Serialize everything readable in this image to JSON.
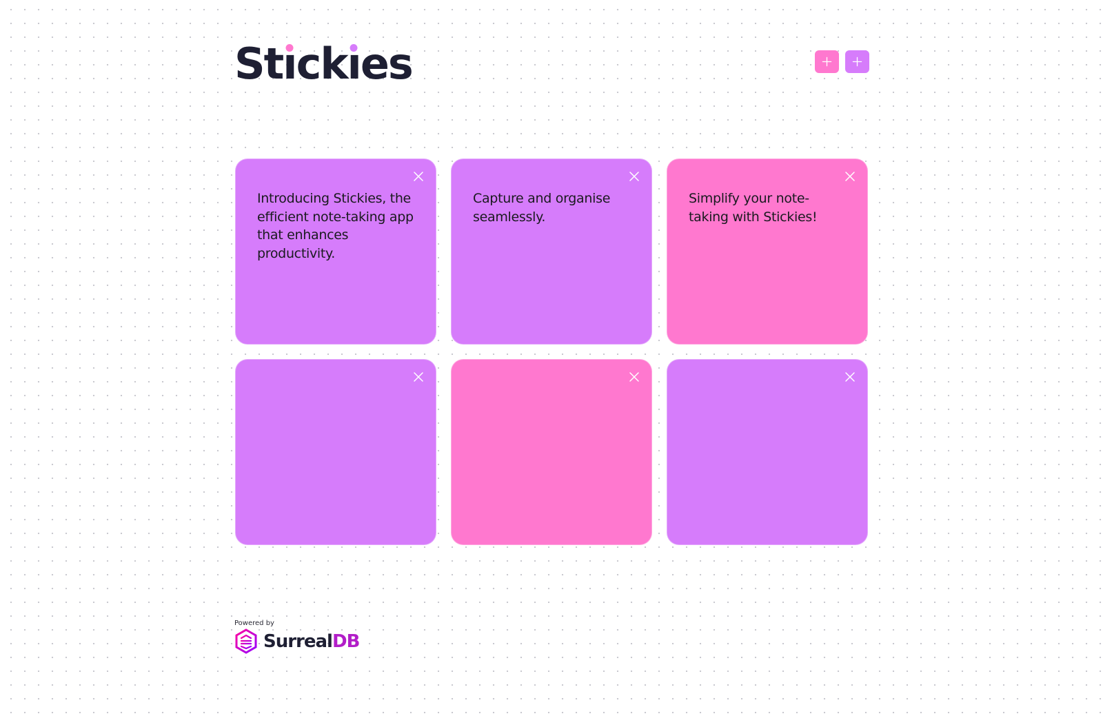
{
  "app": {
    "logo_parts": [
      "St",
      "ck",
      "es"
    ],
    "logo_i": "i"
  },
  "header": {
    "add_pink_label": "+",
    "add_purple_label": "+"
  },
  "colors": {
    "pink": "#ff78cf",
    "purple": "#d67cfb",
    "logo_text": "#1e1f33",
    "surreal_db_accent": "#b21ec8"
  },
  "notes": [
    {
      "text": "Introducing Stickies, the efficient note-taking app that enhances productivity.",
      "color": "purple"
    },
    {
      "text": "Capture and organise seamlessly.",
      "color": "purple"
    },
    {
      "text": "Simplify your note-taking with Stickies!",
      "color": "pink"
    },
    {
      "text": "",
      "color": "purple"
    },
    {
      "text": "",
      "color": "pink"
    },
    {
      "text": "",
      "color": "purple"
    }
  ],
  "footer": {
    "powered_by": "Powered by",
    "brand_main": "Surreal",
    "brand_accent": "DB"
  }
}
